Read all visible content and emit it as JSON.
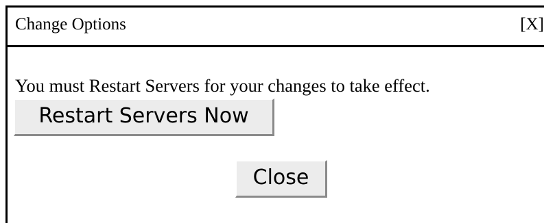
{
  "dialog": {
    "title": "Change Options",
    "close_label": "[X]",
    "message": "You must Restart Servers for your changes to take effect.",
    "restart_button_label": "Restart Servers Now",
    "close_button_label": "Close"
  }
}
